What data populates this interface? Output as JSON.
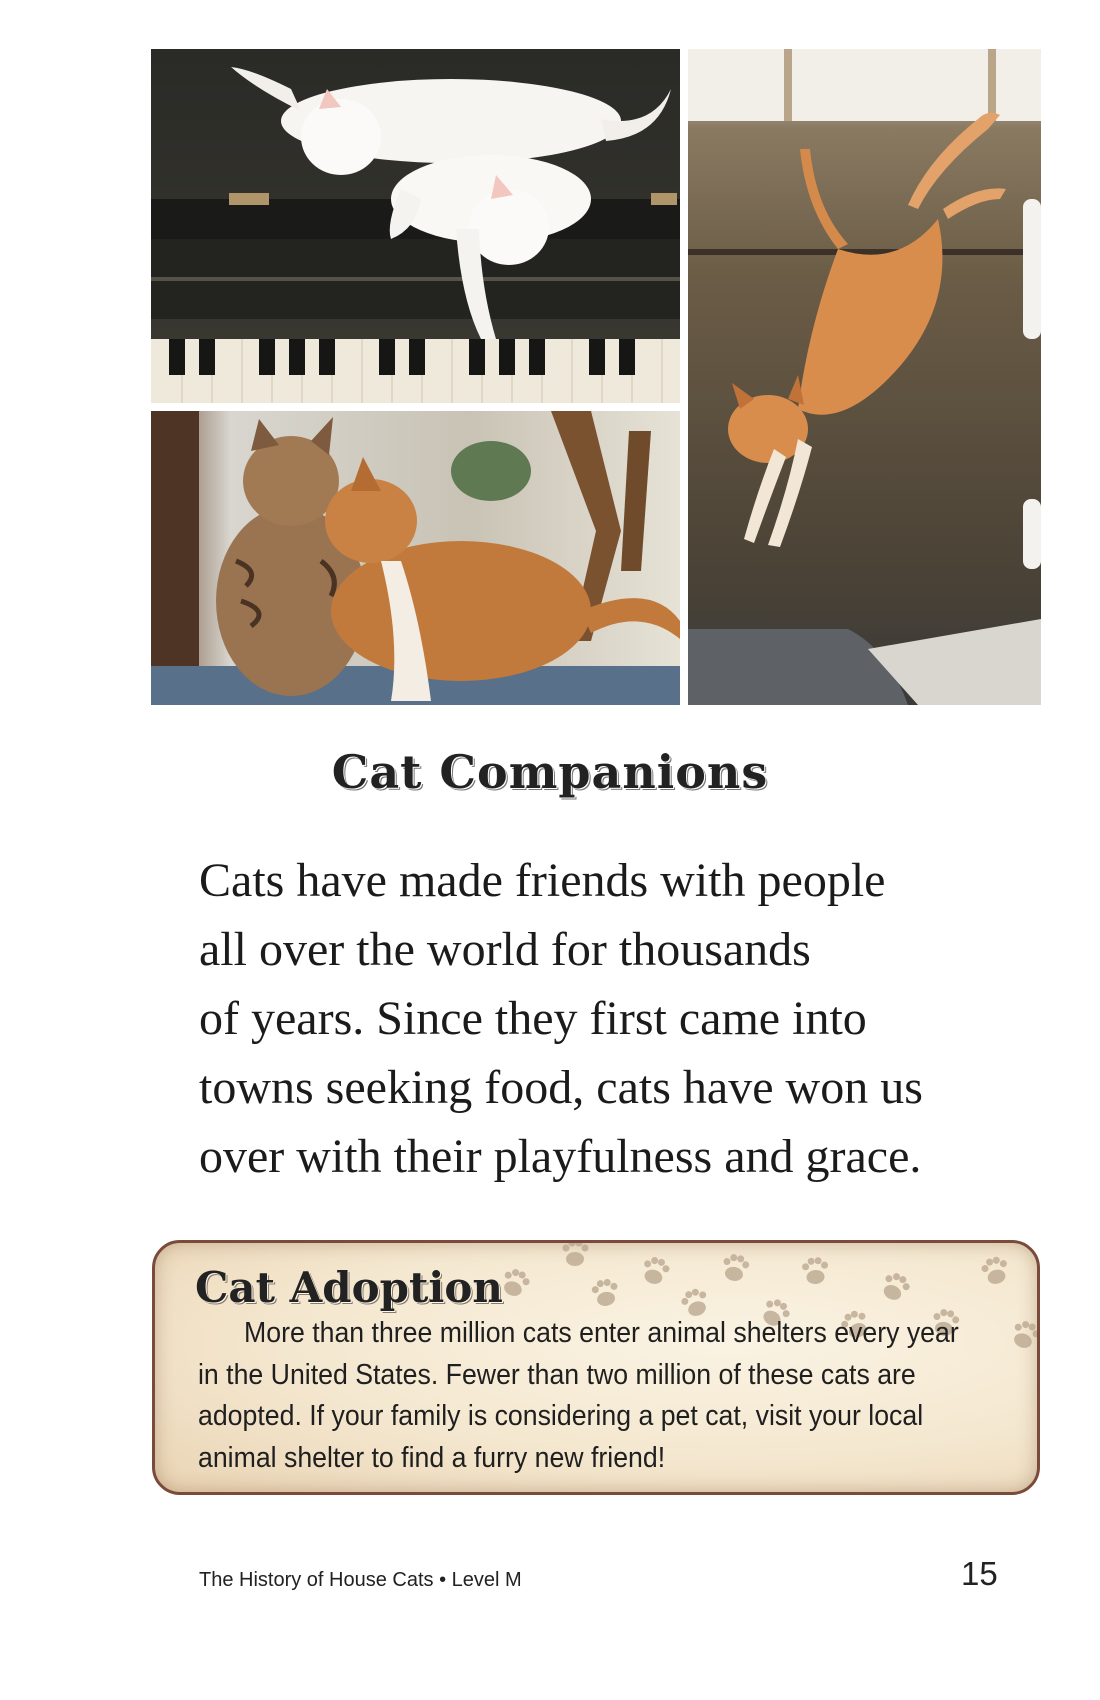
{
  "heading": "Cat Companions",
  "body_lines": [
    "Cats have made friends with people",
    "all over the world for thousands",
    "of years. Since they first came into",
    "towns seeking food, cats have won us",
    "over with their playfulness and grace."
  ],
  "sidebar": {
    "title": "Cat Adoption",
    "lines": [
      "More than three million cats enter animal shelters every year",
      "in the United States. Fewer than two million of these cats are",
      "adopted. If your family is considering a pet cat, visit your local",
      "animal shelter to find a furry new friend!"
    ]
  },
  "footer": {
    "book_title": "The History of House Cats • Level M",
    "page_number": "15"
  },
  "colors": {
    "box_border": "#7a4a3a",
    "box_fill": "#f4e7cf",
    "paw_print": "#b8a48c"
  }
}
